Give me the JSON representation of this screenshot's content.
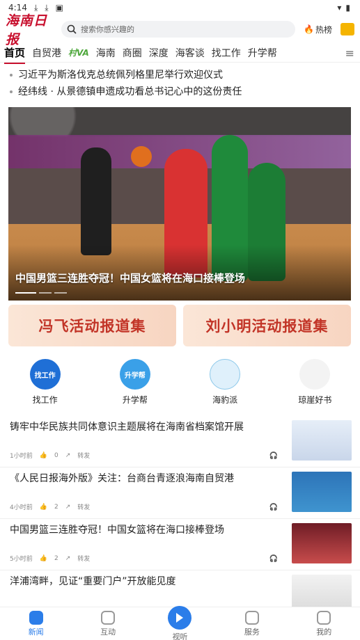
{
  "status": {
    "time": "4:14"
  },
  "header": {
    "logo_text": "海南日报",
    "search_placeholder": "搜索你感兴趣的",
    "hot_label": "热榜"
  },
  "tabs": [
    {
      "label": "首页"
    },
    {
      "label": "自贸港"
    },
    {
      "label": "村VA"
    },
    {
      "label": "海南"
    },
    {
      "label": "商圈"
    },
    {
      "label": "深度"
    },
    {
      "label": "海客谈"
    },
    {
      "label": "找工作"
    },
    {
      "label": "升学帮"
    }
  ],
  "headlines": [
    "习近平为斯洛伐克总统佩列格里尼举行欢迎仪式",
    "经纬线 · 从景德镇申遗成功看总书记心中的这份责任"
  ],
  "hero": {
    "caption": "中国男篮三连胜夺冠！中国女篮将在海口接棒登场"
  },
  "banners": [
    "冯飞活动报道集",
    "刘小明活动报道集"
  ],
  "services": [
    "找工作",
    "升学帮",
    "海豹派",
    "琼崖好书"
  ],
  "service_icons": [
    "找工作",
    "升学帮"
  ],
  "news": [
    {
      "title": "铸牢中华民族共同体意识主题展将在海南省档案馆开展",
      "time": "1小时前",
      "likes": "0",
      "share": "转发"
    },
    {
      "title": "《人民日报海外版》关注：台商台青逐浪海南自贸港",
      "time": "4小时前",
      "likes": "2",
      "share": "转发"
    },
    {
      "title": "中国男篮三连胜夺冠！中国女篮将在海口接棒登场",
      "time": "5小时前",
      "likes": "2",
      "share": "转发"
    },
    {
      "title": "洋浦湾畔，见证“重要门户”开放能见度",
      "time": "",
      "likes": "",
      "share": ""
    }
  ],
  "bottom_nav": [
    "新闻",
    "互动",
    "视听",
    "服务",
    "我的"
  ]
}
